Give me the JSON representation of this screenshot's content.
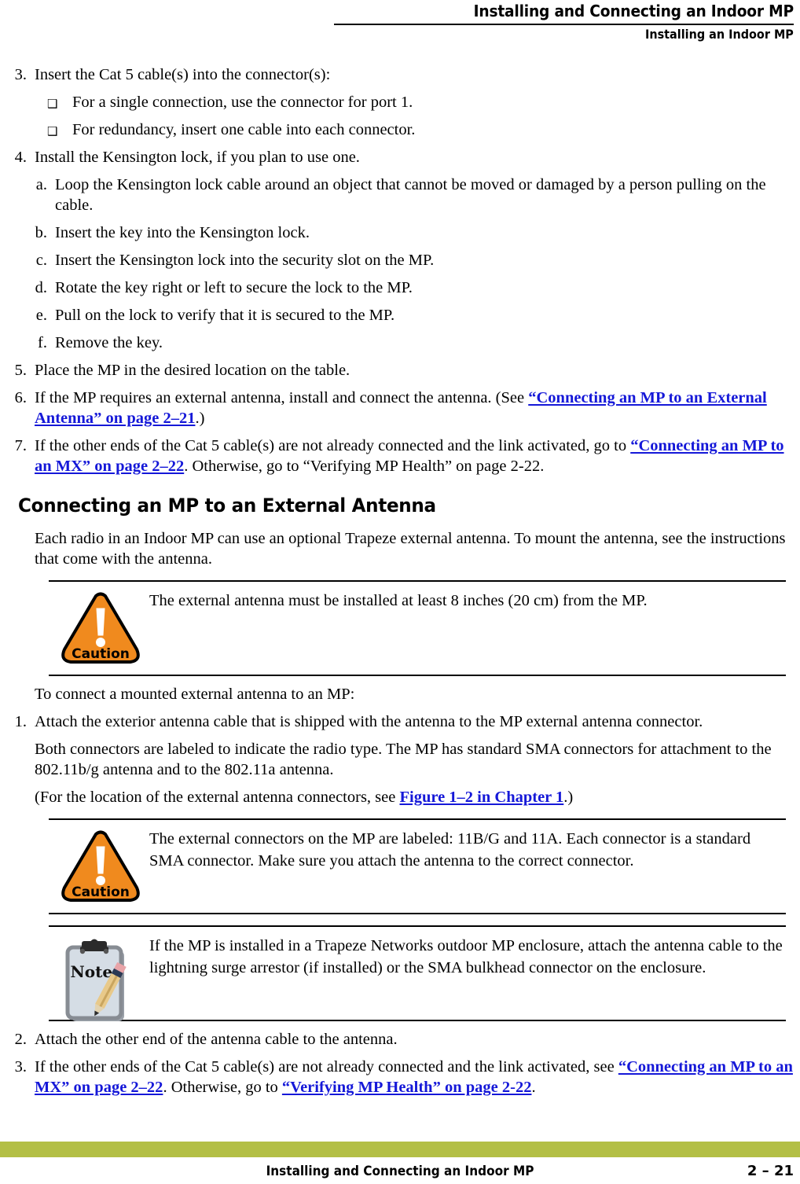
{
  "header": {
    "title": "Installing and Connecting an Indoor MP",
    "subtitle": "Installing an Indoor MP"
  },
  "accent_colors": {
    "link_blue": "#1518D8",
    "caution_orange": "#F08A1E",
    "footer_green": "#B3BF45",
    "note_clipboard_fill": "#D5DDE5",
    "note_clipboard_border": "#878C93"
  },
  "steps_top": [
    {
      "marker": "3.",
      "text": "Insert the Cat 5 cable(s) into the connector(s):",
      "bullets": [
        {
          "marker": "❑",
          "text": "For a single connection, use the connector for port 1."
        },
        {
          "marker": "❑",
          "text": "For redundancy, insert one cable into each connector."
        }
      ]
    },
    {
      "marker": "4.",
      "text": "Install the Kensington lock, if you plan to use one.",
      "substeps": [
        {
          "marker": "a.",
          "text": "Loop the Kensington lock cable around an object that cannot be moved or damaged by a person pulling on the cable."
        },
        {
          "marker": "b.",
          "text": "Insert the key into the Kensington lock."
        },
        {
          "marker": "c.",
          "text": "Insert the Kensington lock into the security slot on the MP."
        },
        {
          "marker": "d.",
          "text": "Rotate the key right or left to secure the lock to the MP."
        },
        {
          "marker": "e.",
          "text": "Pull on the lock to verify that it is secured to the MP."
        },
        {
          "marker": "f.",
          "text": "Remove the key."
        }
      ]
    },
    {
      "marker": "5.",
      "text": "Place the MP in the desired location on the table."
    },
    {
      "marker": "6.",
      "pre": "If the MP requires an external antenna, install and connect the antenna. (See ",
      "link": "“Connecting an MP to an External Antenna” on page 2–21",
      "post": ".)"
    },
    {
      "marker": "7.",
      "pre": "If the other ends of the Cat 5 cable(s) are not already connected and the link activated, go to ",
      "link": "“Connecting an MP to an MX” on page 2–22",
      "post": ". Otherwise, go to “Verifying MP Health” on page 2-22."
    }
  ],
  "section": {
    "heading": "Connecting an MP to an External Antenna",
    "intro": "Each radio in an Indoor MP can use an optional Trapeze external antenna. To mount the antenna, see the instructions that come with the antenna."
  },
  "caution1": {
    "icon_label": "Caution",
    "text": "The external antenna must be installed at least 8 inches (20 cm) from the MP."
  },
  "lead_in": "To connect a mounted external antenna to an MP:",
  "steps_bottom": [
    {
      "marker": "1.",
      "text": "Attach the exterior antenna cable that is shipped with the antenna to the MP external antenna connector.",
      "paras": [
        {
          "text": "Both connectors are labeled to indicate the radio type. The MP has standard SMA connectors for attachment to the 802.11b/g antenna and to the 802.11a antenna."
        },
        {
          "pre": "(For the location of the external antenna connectors, see ",
          "link": "Figure 1–2 in Chapter 1",
          "post": ".)"
        }
      ]
    }
  ],
  "caution2": {
    "icon_label": "Caution",
    "text": "The external connectors on the MP are labeled: 11B/G and 11A. Each connector is a standard SMA connector. Make sure you attach the antenna to the correct connector."
  },
  "note1": {
    "icon_label": "Note:",
    "text": "If the MP is installed in a Trapeze Networks outdoor MP enclosure, attach the antenna cable to the lightning surge arrestor (if installed) or the SMA bulkhead connector on the enclosure."
  },
  "steps_final": [
    {
      "marker": "2.",
      "text": "Attach the other end of the antenna cable to the antenna."
    },
    {
      "marker": "3.",
      "pre": "If the other ends of the Cat 5 cable(s) are not already connected and the link activated, see ",
      "link": "“Connecting an MP to an MX” on page 2–22",
      "mid": ". Otherwise, go to ",
      "link2": "“Verifying MP Health” on page 2-22",
      "post": "."
    }
  ],
  "footer": {
    "label": "Installing and Connecting an Indoor MP",
    "page_number": "2 – 21"
  }
}
